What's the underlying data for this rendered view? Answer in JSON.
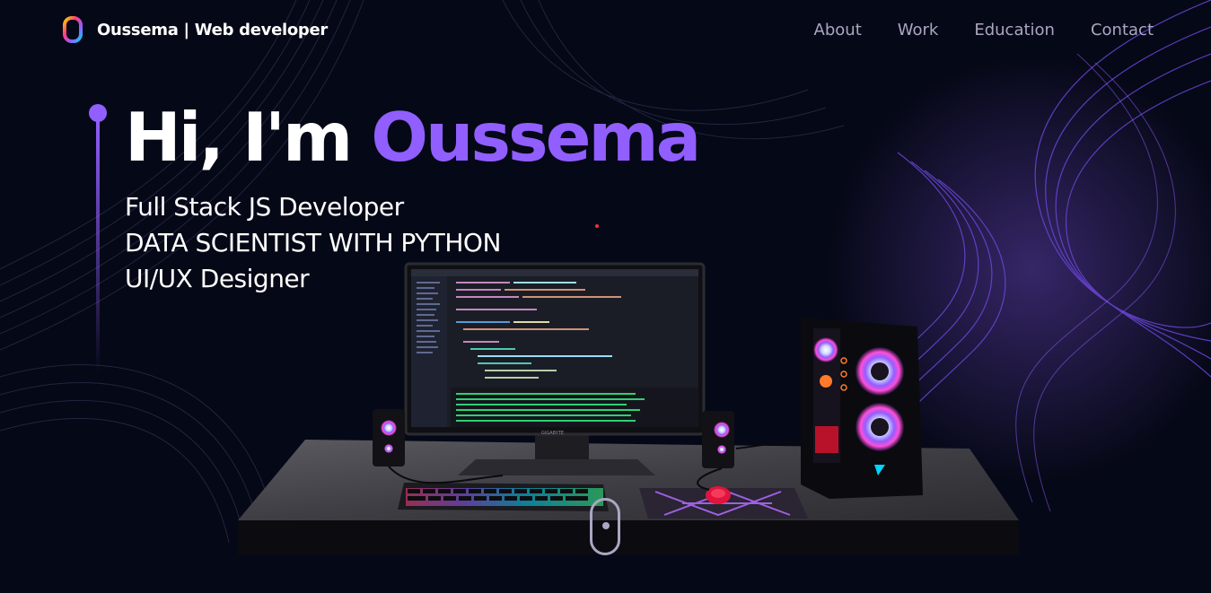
{
  "brand": {
    "name": "Oussema",
    "tagline": "| Web developer"
  },
  "nav": {
    "items": [
      {
        "label": "About"
      },
      {
        "label": "Work"
      },
      {
        "label": "Education"
      },
      {
        "label": "Contact"
      }
    ]
  },
  "hero": {
    "greeting": "Hi, I'm",
    "name": "Oussema",
    "subtitles": [
      "Full Stack JS Developer",
      "DATA SCIENTIST WITH PYTHON",
      "UI/UX Designer"
    ]
  },
  "monitor": {
    "brand": "GIGABYTE"
  },
  "colors": {
    "background": "#050816",
    "accent": "#915eff",
    "nav_text": "#aaa6c3",
    "white": "#ffffff"
  },
  "icons": {
    "logo": "gradient-o-logo-icon",
    "scroll": "mouse-scroll-icon"
  }
}
